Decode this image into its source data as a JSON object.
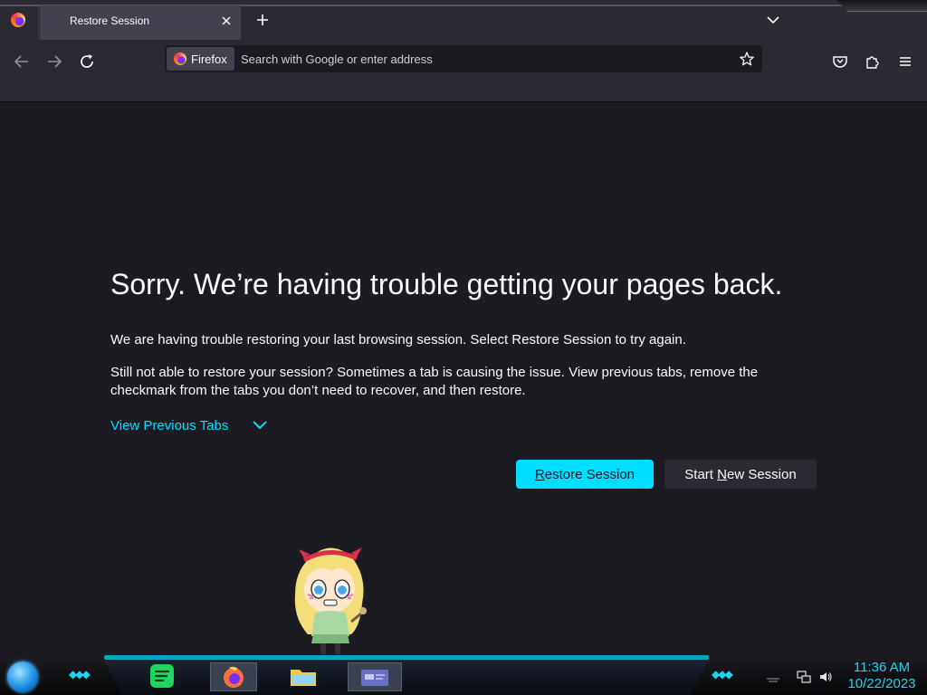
{
  "browser": {
    "tab": {
      "title": "Restore Session",
      "close_icon": "close-icon"
    },
    "new_tab_icon": "plus-icon",
    "tab_list_icon": "chevron-down-icon",
    "nav": {
      "back_icon": "arrow-left-icon",
      "forward_icon": "arrow-right-icon",
      "reload_icon": "reload-icon"
    },
    "urlbar": {
      "identity_label": "Firefox",
      "placeholder": "Search with Google or enter address",
      "value": "",
      "bookmark_icon": "star-icon"
    },
    "toolbar_icons": [
      "pocket-icon",
      "extensions-icon",
      "menu-icon"
    ]
  },
  "page": {
    "heading": "Sorry. We’re having trouble getting your pages back.",
    "paragraph1": "We are having trouble restoring your last browsing session. Select Restore Session to try again.",
    "paragraph2": "Still not able to restore your session? Sometimes a tab is causing the issue. View previous tabs, remove the checkmark from the tabs you don’t need to recover, and then restore.",
    "view_previous_tabs": "View Previous Tabs",
    "restore_button": {
      "before": "",
      "accesskey": "R",
      "after": "estore Session"
    },
    "new_session_button": {
      "before": "Start ",
      "accesskey": "N",
      "after": "ew Session"
    }
  },
  "colors": {
    "accent": "#00ddff",
    "background": "#1c1b22",
    "toolbar": "#2b2a33",
    "tab_active": "#42414d",
    "clock": "#22d3ee"
  },
  "taskbar": {
    "apps": [
      "spotify-icon",
      "firefox-icon",
      "file-explorer-icon",
      "window-app-icon"
    ],
    "tray_icons": [
      "network-icon",
      "volume-icon"
    ],
    "clock": {
      "time": "11:36 AM",
      "date": "10/22/2023"
    }
  }
}
